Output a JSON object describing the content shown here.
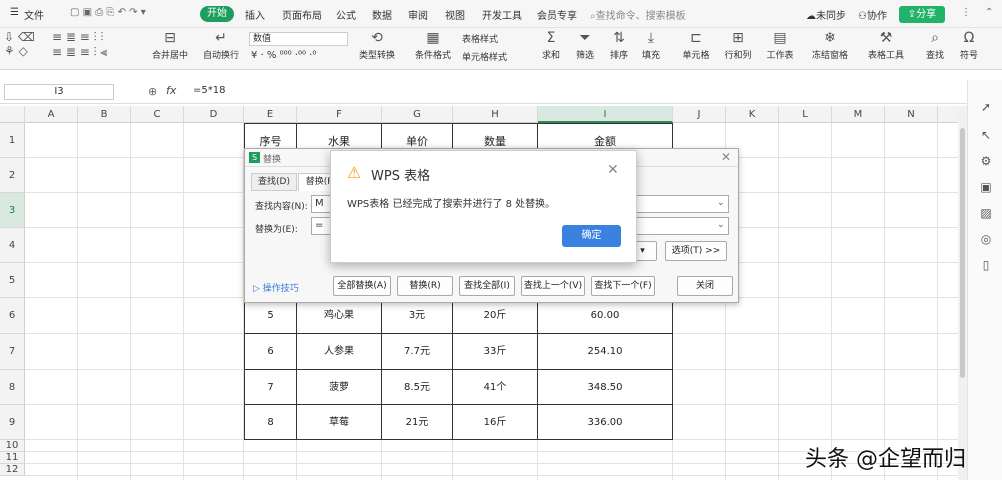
{
  "menubar": {
    "items": [
      "文件",
      "开始",
      "插入",
      "页面布局",
      "公式",
      "数据",
      "审阅",
      "视图",
      "开发工具",
      "会员专享"
    ],
    "search": "查找命令、搜索模板",
    "sync": "未同步",
    "collab": "协作",
    "share": "分享"
  },
  "ribbon": {
    "font": "数值",
    "number_format_symbols": "¥ · % ⁰⁰⁰ ·⁰⁰ ·⁰",
    "labels": [
      "合并居中",
      "自动换行",
      "类型转换",
      "条件格式",
      "表格样式",
      "单元格样式",
      "求和",
      "筛选",
      "排序",
      "填充",
      "单元格",
      "行和列",
      "工作表",
      "冻结窗格",
      "表格工具",
      "查找",
      "符号"
    ]
  },
  "formula": {
    "cell": "I3",
    "fx": "fx",
    "value": "=5*18"
  },
  "sheet": {
    "columns": [
      "A",
      "B",
      "C",
      "D",
      "E",
      "F",
      "G",
      "H",
      "I",
      "J",
      "K",
      "L",
      "M",
      "N"
    ],
    "selected_col": "I",
    "rows": [
      "1",
      "2",
      "3",
      "4",
      "5",
      "6",
      "7",
      "8",
      "9",
      "10",
      "11",
      "12"
    ],
    "selected_row": "3",
    "header": [
      "序号",
      "水果",
      "单价",
      "数量",
      "金额"
    ],
    "data": [
      [
        "5",
        "鸡心果",
        "3元",
        "20斤",
        "60.00"
      ],
      [
        "6",
        "人参果",
        "7.7元",
        "33斤",
        "254.10"
      ],
      [
        "7",
        "菠萝",
        "8.5元",
        "41个",
        "348.50"
      ],
      [
        "8",
        "草莓",
        "21元",
        "16斤",
        "336.00"
      ]
    ]
  },
  "replace_dialog": {
    "title": "替换",
    "tabs": [
      "查找(D)",
      "替换(P)"
    ],
    "find_label": "查找内容(N):",
    "find_value": "M",
    "replace_label": "替换为(E):",
    "replace_value": "=",
    "special_dropdown": "J) ▾",
    "options_button": "选项(T) >>",
    "tips": "操作技巧",
    "buttons": [
      "全部替换(A)",
      "替换(R)",
      "查找全部(I)",
      "查找上一个(V)",
      "查找下一个(F)"
    ],
    "close": "关闭"
  },
  "message": {
    "title": "WPS 表格",
    "body": "WPS表格 已经完成了搜索并进行了 8 处替换。",
    "ok": "确定"
  },
  "watermark": "头条 @企望而归",
  "colors": {
    "accent": "#1e9e5e",
    "ok_button": "#3b82e0",
    "warning": "#f0a020"
  }
}
